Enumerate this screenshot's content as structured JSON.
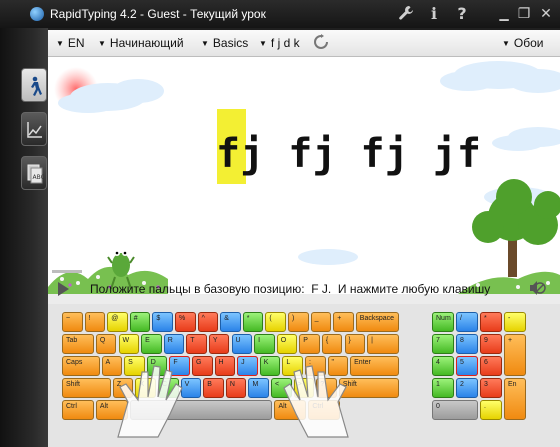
{
  "window": {
    "title": "RapidTyping 4.2 - Guest - Текущий урок",
    "buttons": [
      "wrench-icon",
      "info-icon",
      "help-icon",
      "minimize-icon",
      "restore-icon",
      "close-icon"
    ],
    "btn_glyphs": {
      "info": "i",
      "help": "?",
      "minimize": "▁",
      "restore": "❐",
      "close": "✕"
    }
  },
  "sidebar": {
    "items": [
      {
        "name": "lesson",
        "icon": "walking-man-icon"
      },
      {
        "name": "statistics",
        "icon": "chart-icon"
      },
      {
        "name": "editor",
        "icon": "abc-document-icon"
      }
    ]
  },
  "toolbar": {
    "language": "EN",
    "level": "Начинающий",
    "course": "Basics",
    "lesson": "f j d k",
    "skins": "Обои"
  },
  "lesson": {
    "text": "fj fj fj jf",
    "current_char": "f"
  },
  "status": {
    "message": "Положите пальцы в базовую позицию:  F J.  И нажмите любую клавишу"
  },
  "keyboard": {
    "rows": [
      [
        [
          "~",
          "o"
        ],
        [
          "!",
          "o"
        ],
        [
          "@",
          "y"
        ],
        [
          "#",
          "g"
        ],
        [
          "$",
          "b"
        ],
        [
          "%",
          "r"
        ],
        [
          "^",
          "r"
        ],
        [
          "&",
          "b"
        ],
        [
          "*",
          "g"
        ],
        [
          "(",
          "y"
        ],
        [
          ")",
          "o"
        ],
        [
          "_",
          "o"
        ],
        [
          "+",
          "o"
        ],
        [
          "Backspace",
          "o"
        ]
      ],
      [
        [
          "Tab",
          "o"
        ],
        [
          "Q",
          "o"
        ],
        [
          "W",
          "y"
        ],
        [
          "E",
          "g"
        ],
        [
          "R",
          "b"
        ],
        [
          "T",
          "r"
        ],
        [
          "Y",
          "r"
        ],
        [
          "U",
          "b"
        ],
        [
          "I",
          "g"
        ],
        [
          "O",
          "y"
        ],
        [
          "P",
          "o"
        ],
        [
          "{",
          "o"
        ],
        [
          "}",
          "o"
        ],
        [
          "|",
          "o"
        ]
      ],
      [
        [
          "Caps",
          "o"
        ],
        [
          "A",
          "o"
        ],
        [
          "S",
          "y"
        ],
        [
          "D",
          "g"
        ],
        [
          "F",
          "b"
        ],
        [
          "G",
          "r"
        ],
        [
          "H",
          "r"
        ],
        [
          "J",
          "b"
        ],
        [
          "K",
          "g"
        ],
        [
          "L",
          "y"
        ],
        [
          ":",
          "o"
        ],
        [
          "\"",
          "o"
        ],
        [
          "Enter",
          "o"
        ]
      ],
      [
        [
          "Shift",
          "o"
        ],
        [
          "Z",
          "o"
        ],
        [
          "X",
          "y"
        ],
        [
          "C",
          "g"
        ],
        [
          "V",
          "b"
        ],
        [
          "B",
          "r"
        ],
        [
          "N",
          "r"
        ],
        [
          "M",
          "b"
        ],
        [
          "<",
          "g"
        ],
        [
          ">",
          "y"
        ],
        [
          "?",
          "o"
        ],
        [
          "Shift",
          "o"
        ]
      ],
      [
        [
          "Ctrl",
          "o"
        ],
        [
          "Alt",
          "o"
        ],
        [
          "",
          "gr"
        ],
        [
          "Alt",
          "o"
        ],
        [
          "Ctrl",
          "o"
        ]
      ]
    ],
    "numpad": [
      [
        "Num",
        "/",
        "*",
        "-"
      ],
      [
        "7",
        "8",
        "9",
        "+"
      ],
      [
        "4",
        "5",
        "6"
      ],
      [
        "1",
        "2",
        "3",
        "En"
      ],
      [
        "0",
        "."
      ]
    ],
    "highlighted_keys": [
      "F",
      "J"
    ],
    "colors": {
      "orange": "#f08a10",
      "yellow": "#e6d200",
      "green": "#45b924",
      "blue": "#2b83e8",
      "red": "#e83c1a"
    }
  }
}
